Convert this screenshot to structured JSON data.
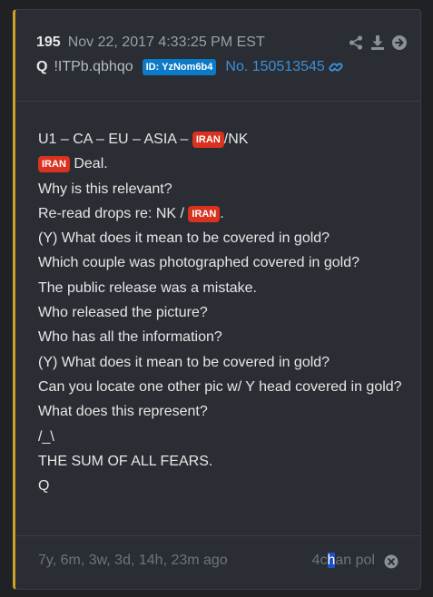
{
  "post": {
    "number": "195",
    "timestamp": "Nov 22, 2017 4:33:25 PM EST",
    "author": "Q",
    "tripcode": "!ITPb.qbhqo",
    "id_badge": "ID: YzNom6b4",
    "post_no": "No. 150513545"
  },
  "body": {
    "line1_pre": "U1 – CA – EU – ASIA – ",
    "line1_tag": "IRAN",
    "line1_post": "/NK",
    "line2_tag": "IRAN",
    "line2_post": " Deal.",
    "line3": "Why is this relevant?",
    "line4_pre": "Re-read drops re: NK / ",
    "line4_tag": "IRAN",
    "line4_post": ".",
    "line5": "(Y) What does it mean to be covered in gold?",
    "line6": "Which couple was photographed covered in gold?",
    "line7": "The public release was a mistake.",
    "line8": "Who released the picture?",
    "line9": "Who has all the information?",
    "line10": "(Y) What does it mean to be covered in gold?",
    "line11": "Can you locate one other pic w/ Y head covered in gold?",
    "line12": "What does this represent?",
    "line13": "/_\\",
    "line14": "THE SUM OF ALL FEARS.",
    "line15": "Q"
  },
  "footer": {
    "age": "7y, 6m, 3w, 3d, 14h, 23m ago",
    "source_pre": "4c",
    "source_hl": "h",
    "source_post": "an pol"
  },
  "icons": {
    "share": "share-icon",
    "download": "download-icon",
    "goto": "arrow-circle-right-icon",
    "link": "link-icon",
    "close": "close-circle-icon"
  },
  "colors": {
    "accent_border": "#c9a227",
    "id_badge": "#0c7ac9",
    "tag": "#d9321f",
    "link": "#3d8fd8"
  }
}
